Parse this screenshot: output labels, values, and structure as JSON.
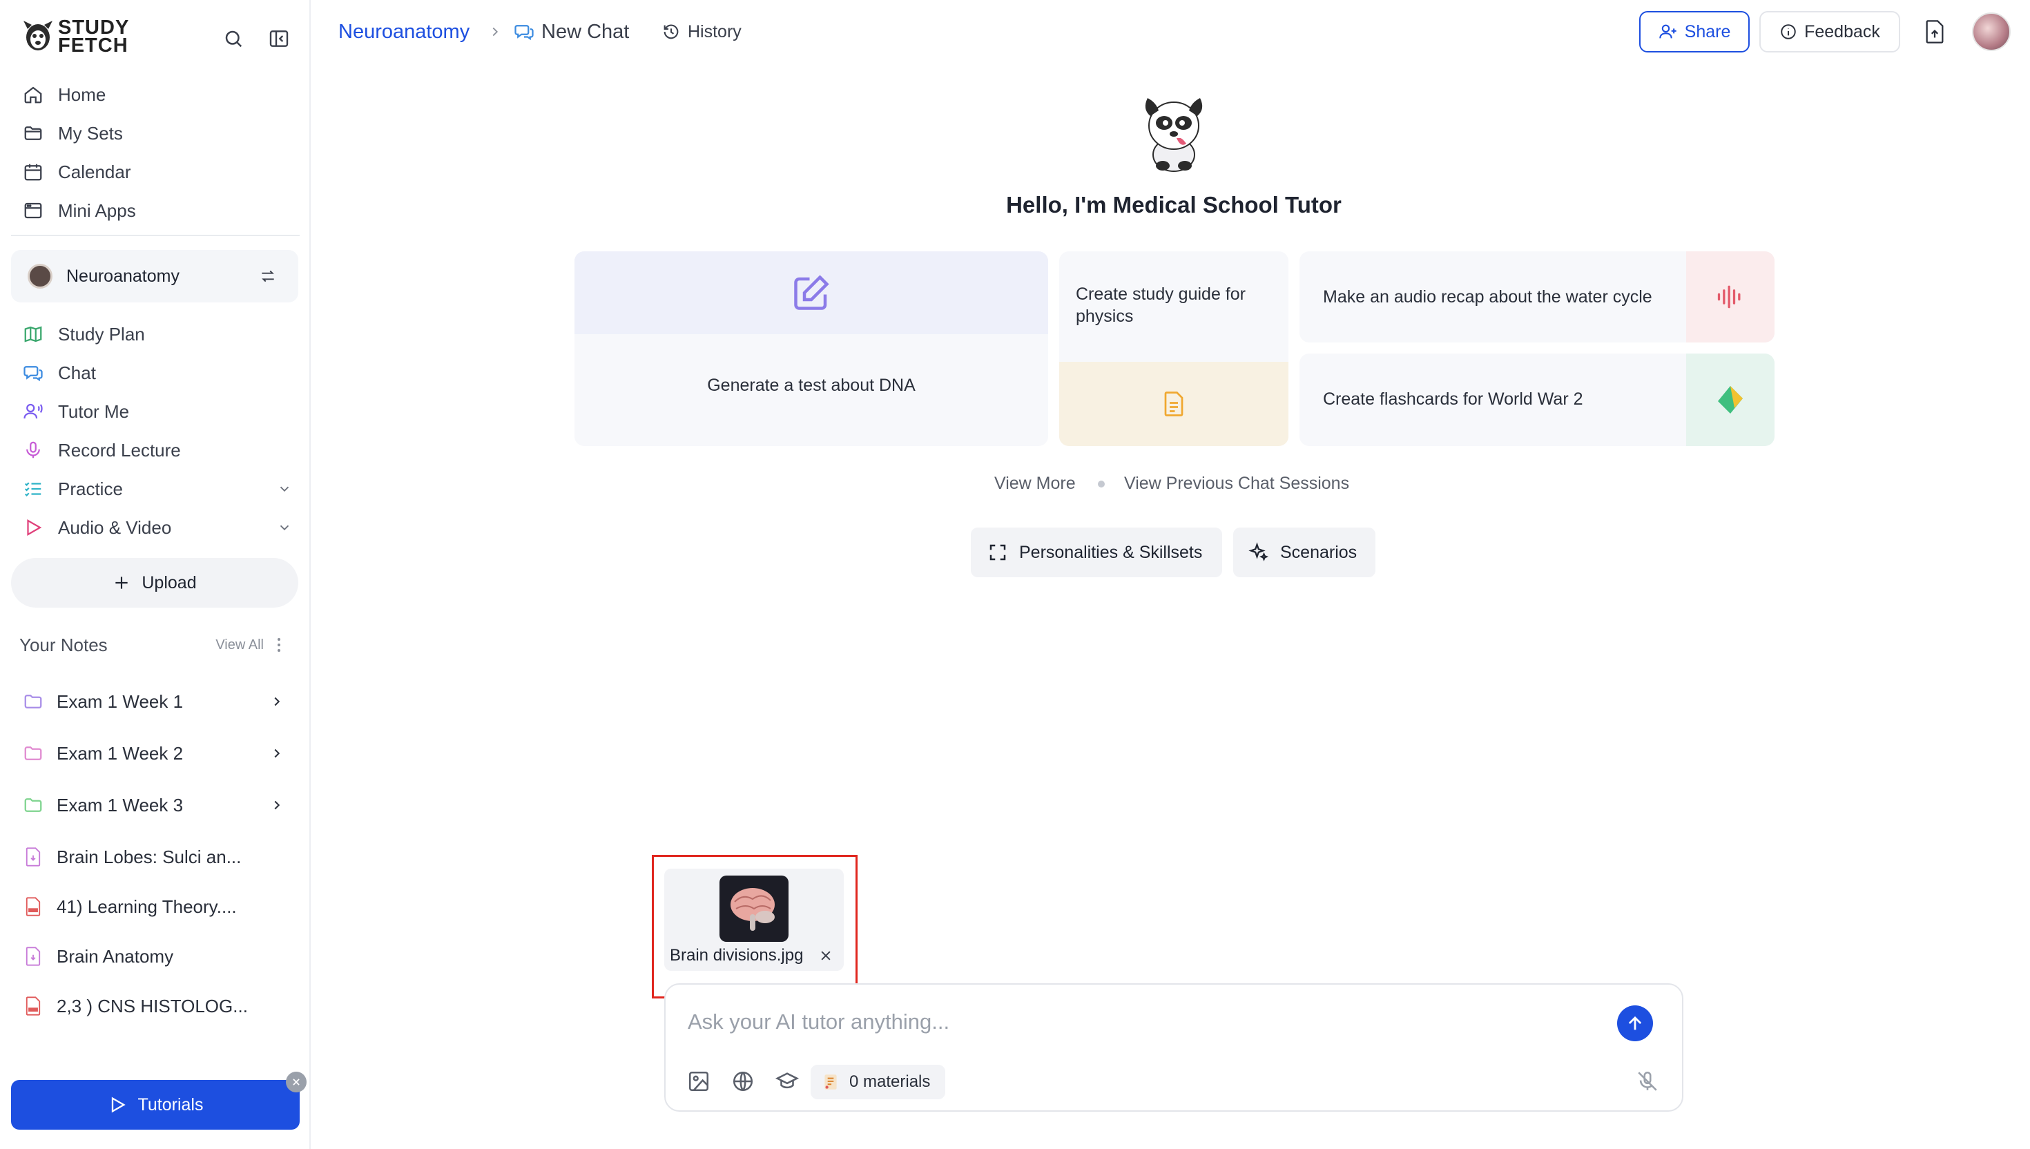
{
  "app": {
    "logo_line1": "STUDY",
    "logo_line2": "FETCH"
  },
  "sidebar": {
    "nav": [
      {
        "label": "Home"
      },
      {
        "label": "My Sets"
      },
      {
        "label": "Calendar"
      },
      {
        "label": "Mini Apps"
      }
    ],
    "course": {
      "label": "Neuroanatomy"
    },
    "tools": [
      {
        "label": "Study Plan"
      },
      {
        "label": "Chat"
      },
      {
        "label": "Tutor Me"
      },
      {
        "label": "Record Lecture"
      },
      {
        "label": "Practice"
      },
      {
        "label": "Audio & Video"
      }
    ],
    "upload_label": "Upload",
    "notes": {
      "title": "Your Notes",
      "view_all": "View All",
      "items": [
        {
          "label": "Exam 1 Week 1"
        },
        {
          "label": "Exam 1 Week 2"
        },
        {
          "label": "Exam 1 Week 3"
        },
        {
          "label": "Brain Lobes: Sulci an..."
        },
        {
          "label": "41) Learning Theory...."
        },
        {
          "label": "Brain Anatomy"
        },
        {
          "label": "2,3 ) CNS HISTOLOG..."
        }
      ]
    },
    "tutorials_label": "Tutorials"
  },
  "header": {
    "breadcrumb_course": "Neuroanatomy",
    "breadcrumb_chat": "New Chat",
    "history_label": "History",
    "share_label": "Share",
    "feedback_label": "Feedback"
  },
  "main": {
    "greeting": "Hello, I'm Medical School Tutor",
    "suggestions": {
      "test": "Generate a test about DNA",
      "guide": "Create study guide for physics",
      "audio": "Make an audio recap about the water cycle",
      "flashcards": "Create flashcards for World War 2"
    },
    "view_more": "View More",
    "view_previous": "View Previous Chat Sessions",
    "chips": {
      "personalities": "Personalities & Skillsets",
      "scenarios": "Scenarios"
    },
    "attachment": {
      "filename": "Brain divisions.jpg"
    },
    "composer": {
      "placeholder": "Ask your AI tutor anything...",
      "materials": "0 materials"
    }
  },
  "colors": {
    "accent": "#1d4fe0",
    "highlight": "#e0261e"
  }
}
